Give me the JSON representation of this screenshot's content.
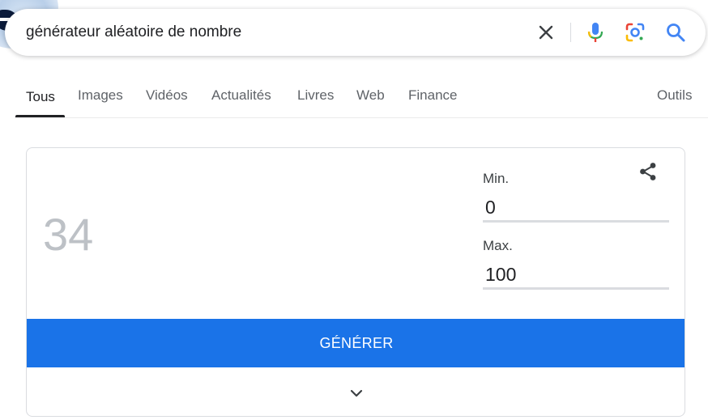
{
  "search": {
    "query": "générateur aléatoire de nombre",
    "icons": [
      "close-icon",
      "microphone-icon",
      "google-lens-icon",
      "search-icon"
    ]
  },
  "tabs": [
    {
      "label": "Tous",
      "active": true
    },
    {
      "label": "Images"
    },
    {
      "label": "Vidéos"
    },
    {
      "label": "Actualités"
    },
    {
      "label": "Livres"
    },
    {
      "label": "Web"
    },
    {
      "label": "Finance"
    }
  ],
  "tools_label": "Outils",
  "generator": {
    "result": "34",
    "min_label": "Min.",
    "min_value": "0",
    "max_label": "Max.",
    "max_value": "100",
    "generate_label": "GÉNÉRER",
    "icons": [
      "share-icon",
      "chevron-down-icon"
    ]
  },
  "colors": {
    "accent": "#1a73e8",
    "result_text": "#bdc1c6",
    "mic_blue": "#4285f4",
    "mic_red": "#ea4335"
  }
}
